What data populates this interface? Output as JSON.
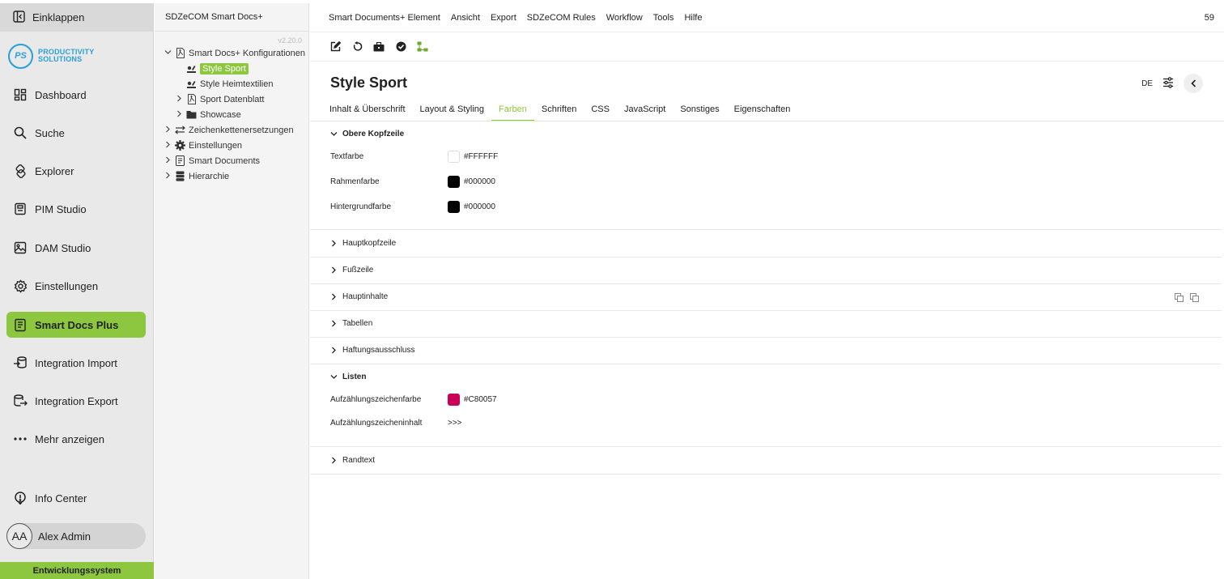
{
  "nav": {
    "collapse_label": "Einklappen",
    "logo": {
      "mark": "PS",
      "line1": "PRODUCTIVITY",
      "line2": "SOLUTIONS"
    },
    "items": [
      {
        "label": "Dashboard",
        "icon": "dashboard-icon"
      },
      {
        "label": "Suche",
        "icon": "search-icon"
      },
      {
        "label": "Explorer",
        "icon": "explorer-icon"
      },
      {
        "label": "PIM Studio",
        "icon": "pim-icon"
      },
      {
        "label": "DAM Studio",
        "icon": "image-icon"
      },
      {
        "label": "Einstellungen",
        "icon": "gear-icon"
      },
      {
        "label": "Smart Docs Plus",
        "icon": "document-icon"
      },
      {
        "label": "Integration Import",
        "icon": "import-icon"
      },
      {
        "label": "Integration Export",
        "icon": "export-icon"
      },
      {
        "label": "Mehr anzeigen",
        "icon": "more-icon"
      }
    ],
    "info_center": "Info Center",
    "user": {
      "initials": "AA",
      "name": "Alex Admin"
    },
    "environment": "Entwicklungssystem",
    "accent": "#8dc63f"
  },
  "tree": {
    "header": "SDZeCOM Smart Docs+",
    "version": "v2.20.0",
    "nodes": [
      {
        "label": "Smart Docs+ Konfigurationen"
      },
      {
        "label": "Style Sport"
      },
      {
        "label": "Style Heimtextilien"
      },
      {
        "label": "Sport Datenblatt"
      },
      {
        "label": "Showcase"
      },
      {
        "label": "Zeichenkettenersetzungen"
      },
      {
        "label": "Einstellungen"
      },
      {
        "label": "Smart Documents"
      },
      {
        "label": "Hierarchie"
      }
    ]
  },
  "menu": {
    "items": [
      "Smart Documents+ Element",
      "Ansicht",
      "Export",
      "SDZeCOM Rules",
      "Workflow",
      "Tools",
      "Hilfe"
    ],
    "number": "59"
  },
  "editor": {
    "title": "Style Sport",
    "language": "DE",
    "tabs": [
      "Inhalt & Überschrift",
      "Layout & Styling",
      "Farben",
      "Schriften",
      "CSS",
      "JavaScript",
      "Sonstiges",
      "Eigenschaften"
    ],
    "active_tab": "Farben",
    "sections": {
      "obere": {
        "title": "Obere Kopfzeile",
        "fields": [
          {
            "label": "Textfarbe",
            "value": "#FFFFFF",
            "color": "#FFFFFF"
          },
          {
            "label": "Rahmenfarbe",
            "value": "#000000",
            "color": "#000000"
          },
          {
            "label": "Hintergrundfarbe",
            "value": "#000000",
            "color": "#000000"
          }
        ]
      },
      "haupt": "Hauptkopfzeile",
      "fuss": "Fußzeile",
      "hauptinhalte": "Hauptinhalte",
      "tabellen": "Tabellen",
      "haftung": "Haftungsausschluss",
      "listen": {
        "title": "Listen",
        "fields": [
          {
            "label": "Aufzählungszeichenfarbe",
            "value": "#C80057",
            "color": "#C80057"
          },
          {
            "label": "Aufzählungszeicheninhalt",
            "value": ">>>"
          }
        ]
      },
      "randtext": "Randtext"
    }
  }
}
